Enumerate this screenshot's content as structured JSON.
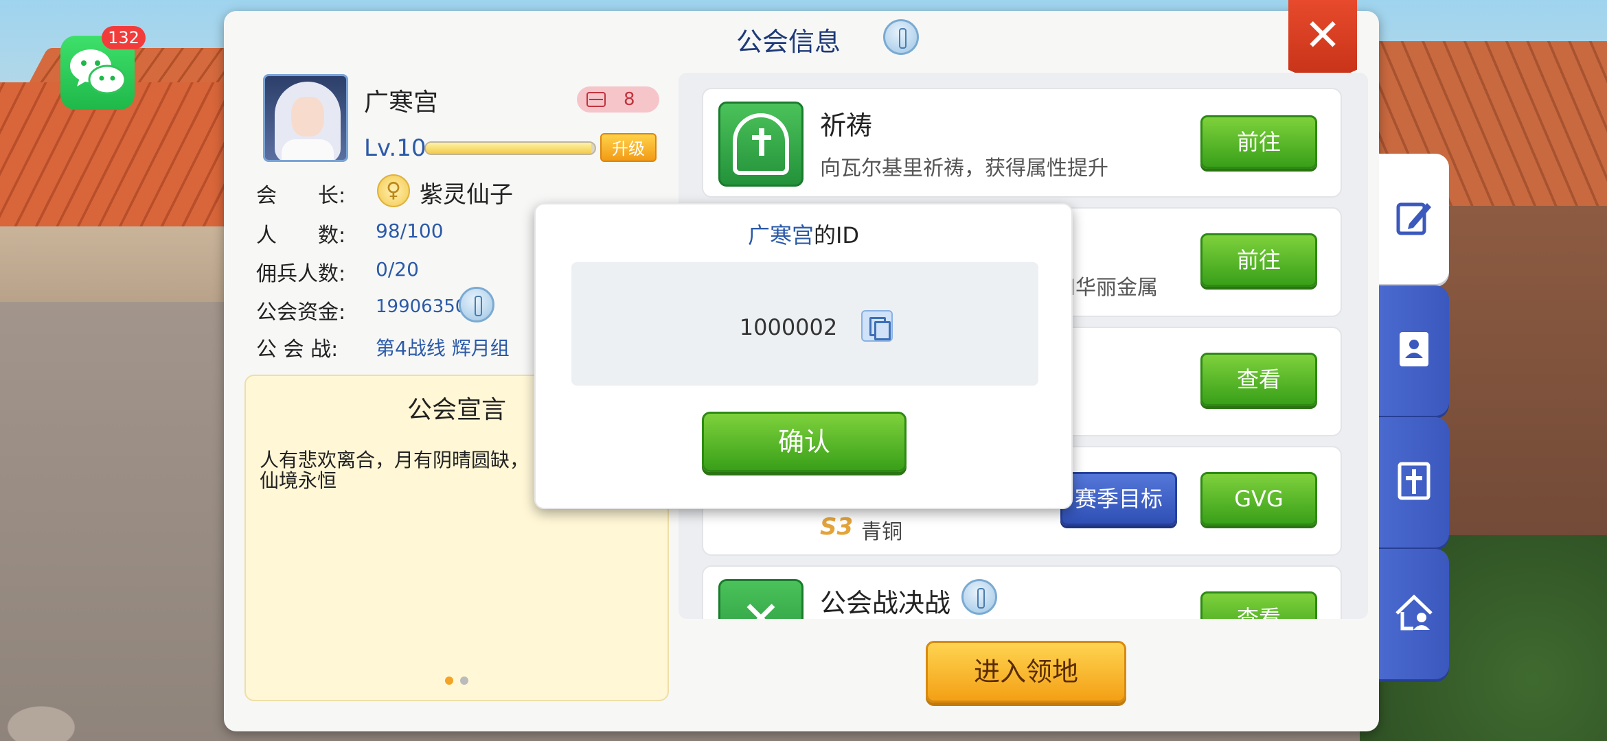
{
  "wechat": {
    "badge": "132",
    "icon": "wechat-icon"
  },
  "panel": {
    "title": "公会信息"
  },
  "guild": {
    "name": "广寒宫",
    "server": "8",
    "level": "Lv.10",
    "level_progress": 0.98,
    "upgrade_label": "升级",
    "rows": [
      {
        "label": "会　　长:",
        "value": "紫灵仙子"
      },
      {
        "label": "人　　数:",
        "value": "98/100"
      },
      {
        "label": "佣兵人数:",
        "value": "0/20"
      },
      {
        "label": "公会资金:",
        "value": "19906350"
      },
      {
        "label": "公 会 战:",
        "value": "第4战线  辉月组"
      }
    ]
  },
  "manifesto": {
    "title": "公会宣言",
    "text": "人有悲欢离合，月有阴晴圆缺，\n仙境永恒",
    "page": 1,
    "pages": 2
  },
  "list": [
    {
      "name": "祈祷",
      "desc": "向瓦尔基里祈祷，获得属性提升",
      "button": "前往"
    },
    {
      "name": "",
      "desc": "和华丽金属",
      "button": "前往"
    },
    {
      "name": "",
      "desc": "",
      "button": "查看"
    },
    {
      "rank_badge": "S3",
      "rank_name": "青铜",
      "season_button": "赛季目标",
      "button": "GVG"
    },
    {
      "name": "公会战决战",
      "button": "查看"
    }
  ],
  "enter_button": "进入领地",
  "side_tabs": [
    "edit-icon",
    "contacts-icon",
    "church-icon",
    "home-icon"
  ],
  "modal": {
    "title_name": "广寒宫",
    "title_suffix": "的ID",
    "id": "1000002",
    "confirm": "确认"
  },
  "colors": {
    "accent_blue": "#2b5aa8",
    "green_button": "#39a019",
    "orange_button": "#f3a015",
    "close_red": "#d63a1e"
  }
}
